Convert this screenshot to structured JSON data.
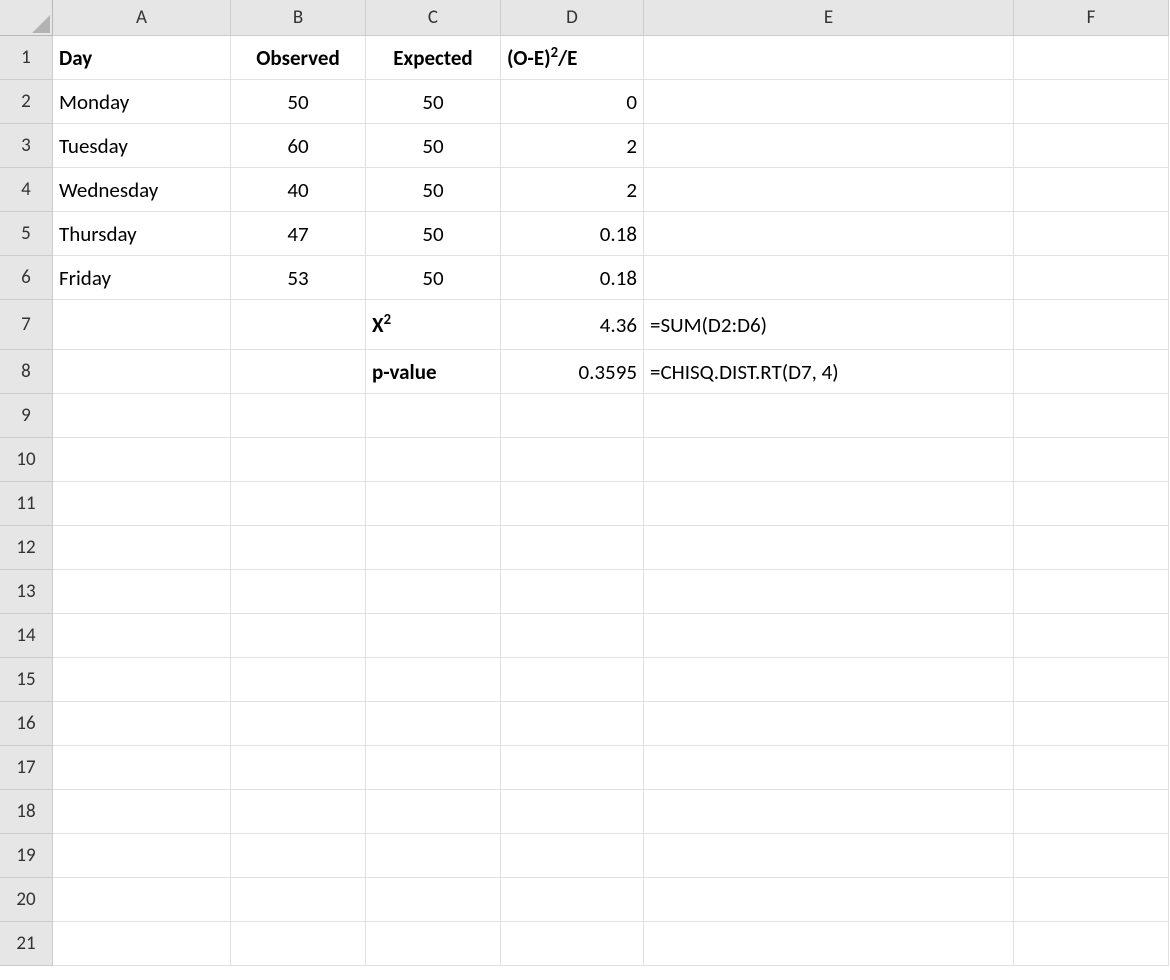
{
  "columns": [
    "A",
    "B",
    "C",
    "D",
    "E",
    "F"
  ],
  "rowCount": 21,
  "headers": {
    "A": "Day",
    "B": "Observed",
    "C": "Expected",
    "D_plain": "(O-E)",
    "D_sup": "2",
    "D_rest": "/E"
  },
  "rows": [
    {
      "day": "Monday",
      "observed": "50",
      "expected": "50",
      "stat": "0"
    },
    {
      "day": "Tuesday",
      "observed": "60",
      "expected": "50",
      "stat": "2"
    },
    {
      "day": "Wednesday",
      "observed": "40",
      "expected": "50",
      "stat": "2"
    },
    {
      "day": "Thursday",
      "observed": "47",
      "expected": "50",
      "stat": "0.18"
    },
    {
      "day": "Friday",
      "observed": "53",
      "expected": "50",
      "stat": "0.18"
    }
  ],
  "summary": {
    "chi_label_plain": "X",
    "chi_label_sup": "2",
    "chi_value": "4.36",
    "chi_formula": "=SUM(D2:D6)",
    "p_label": "p-value",
    "p_value": "0.3595",
    "p_formula": "=CHISQ.DIST.RT(D7, 4)"
  }
}
